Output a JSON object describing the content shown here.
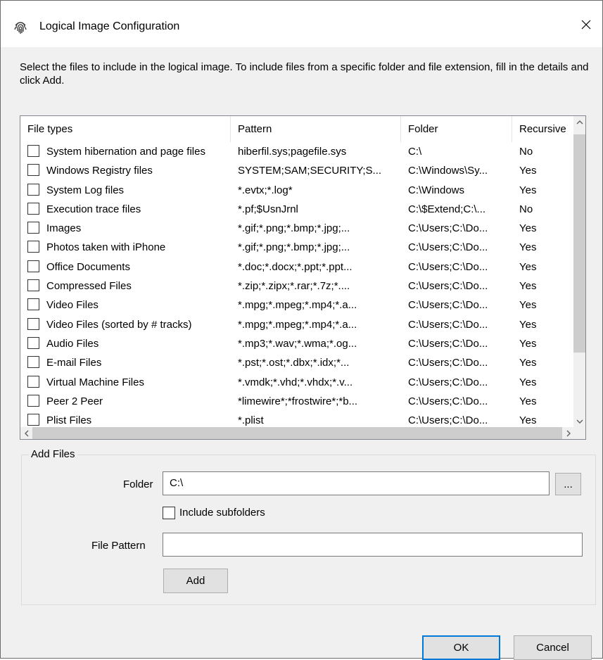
{
  "window": {
    "title": "Logical Image Configuration",
    "close_glyph": "✕",
    "icon": "fingerprint-icon"
  },
  "intro_text": "Select the files to include in the logical image. To include files from a specific folder and file extension, fill in the details and click Add.",
  "list": {
    "columns": [
      "File types",
      "Pattern",
      "Folder",
      "Recursive"
    ],
    "rows": [
      {
        "name": "System hibernation and page files",
        "pattern": "hiberfil.sys;pagefile.sys",
        "folder": "C:\\",
        "recursive": "No"
      },
      {
        "name": "Windows Registry files",
        "pattern": "SYSTEM;SAM;SECURITY;S...",
        "folder": "C:\\Windows\\Sy...",
        "recursive": "Yes"
      },
      {
        "name": "System Log files",
        "pattern": "*.evtx;*.log*",
        "folder": "C:\\Windows",
        "recursive": "Yes"
      },
      {
        "name": "Execution trace files",
        "pattern": "*.pf;$UsnJrnl",
        "folder": "C:\\$Extend;C:\\...",
        "recursive": "No"
      },
      {
        "name": "Images",
        "pattern": "*.gif;*.png;*.bmp;*.jpg;...",
        "folder": "C:\\Users;C:\\Do...",
        "recursive": "Yes"
      },
      {
        "name": "Photos taken with iPhone",
        "pattern": "*.gif;*.png;*.bmp;*.jpg;...",
        "folder": "C:\\Users;C:\\Do...",
        "recursive": "Yes"
      },
      {
        "name": "Office Documents",
        "pattern": "*.doc;*.docx;*.ppt;*.ppt...",
        "folder": "C:\\Users;C:\\Do...",
        "recursive": "Yes"
      },
      {
        "name": "Compressed Files",
        "pattern": "*.zip;*.zipx;*.rar;*.7z;*....",
        "folder": "C:\\Users;C:\\Do...",
        "recursive": "Yes"
      },
      {
        "name": "Video Files",
        "pattern": "*.mpg;*.mpeg;*.mp4;*.a...",
        "folder": "C:\\Users;C:\\Do...",
        "recursive": "Yes"
      },
      {
        "name": "Video Files (sorted by # tracks)",
        "pattern": "*.mpg;*.mpeg;*.mp4;*.a...",
        "folder": "C:\\Users;C:\\Do...",
        "recursive": "Yes"
      },
      {
        "name": "Audio Files",
        "pattern": "*.mp3;*.wav;*.wma;*.og...",
        "folder": "C:\\Users;C:\\Do...",
        "recursive": "Yes"
      },
      {
        "name": "E-mail Files",
        "pattern": "*.pst;*.ost;*.dbx;*.idx;*...",
        "folder": "C:\\Users;C:\\Do...",
        "recursive": "Yes"
      },
      {
        "name": "Virtual Machine Files",
        "pattern": "*.vmdk;*.vhd;*.vhdx;*.v...",
        "folder": "C:\\Users;C:\\Do...",
        "recursive": "Yes"
      },
      {
        "name": "Peer 2 Peer",
        "pattern": "*limewire*;*frostwire*;*b...",
        "folder": "C:\\Users;C:\\Do...",
        "recursive": "Yes"
      },
      {
        "name": "Plist Files",
        "pattern": "*.plist",
        "folder": "C:\\Users;C:\\Do...",
        "recursive": "Yes"
      }
    ]
  },
  "add_files": {
    "group_label": "Add Files",
    "folder_label": "Folder",
    "folder_value": "C:\\",
    "browse_label": "...",
    "include_subfolders_label": "Include subfolders",
    "file_pattern_label": "File Pattern",
    "file_pattern_value": "",
    "add_label": "Add"
  },
  "buttons": {
    "ok": "OK",
    "cancel": "Cancel"
  },
  "colors": {
    "accent": "#0078d7",
    "dialog_bg": "#f0f0f0"
  }
}
